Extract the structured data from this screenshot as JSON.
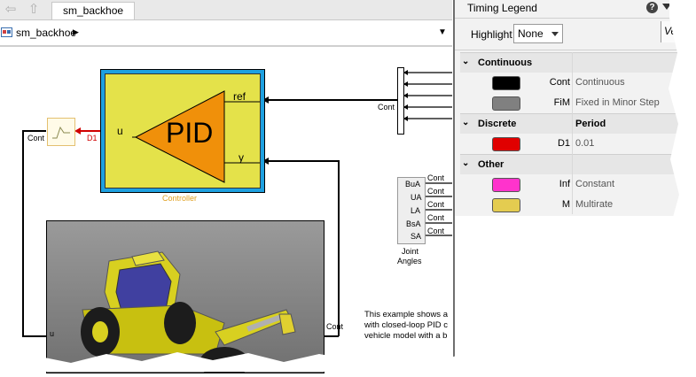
{
  "tabs": {
    "back": "⇦",
    "up": "⇧",
    "model_tab": "sm_backhoe"
  },
  "breadcrumb": {
    "model": "sm_backhoe",
    "arrow": "▶",
    "menu_arrow": "▼"
  },
  "diagram": {
    "controller": {
      "block": "PID",
      "in_u": "u",
      "out_ref": "ref",
      "out_y": "y",
      "caption": "Controller"
    },
    "line_labels": {
      "d1": "D1",
      "cont_left": "Cont",
      "cont_mux": "Cont",
      "cont_bottom": "Cont"
    },
    "joint_angles": {
      "ports": [
        "BuA",
        "UA",
        "LA",
        "BsA",
        "SA"
      ],
      "caption_1": "Joint",
      "caption_2": "Angles",
      "cont_tags": [
        "Cont",
        "Cont",
        "Cont",
        "Cont",
        "Cont"
      ]
    },
    "description": [
      "This example shows a",
      "with closed-loop PID c",
      "vehicle model with a b"
    ],
    "bottom_port_u": "u"
  },
  "legend": {
    "title": "Timing Legend",
    "help": "?",
    "highlight_label": "Highlight",
    "highlight_value": "None",
    "side_tab": "Ve",
    "groups": [
      {
        "name": "Continuous",
        "col2": "",
        "rows": [
          {
            "color": "#000000",
            "tag": "Cont",
            "desc": "Continuous"
          },
          {
            "color": "#808080",
            "tag": "FiM",
            "desc": "Fixed in Minor Step"
          }
        ]
      },
      {
        "name": "Discrete",
        "col2": "Period",
        "rows": [
          {
            "color": "#e00000",
            "tag": "D1",
            "desc": "0.01"
          }
        ]
      },
      {
        "name": "Other",
        "col2": "",
        "rows": [
          {
            "color": "#ff33cc",
            "tag": "Inf",
            "desc": "Constant"
          },
          {
            "color": "#e4cc50",
            "tag": "M",
            "desc": "Multirate"
          }
        ]
      }
    ]
  }
}
